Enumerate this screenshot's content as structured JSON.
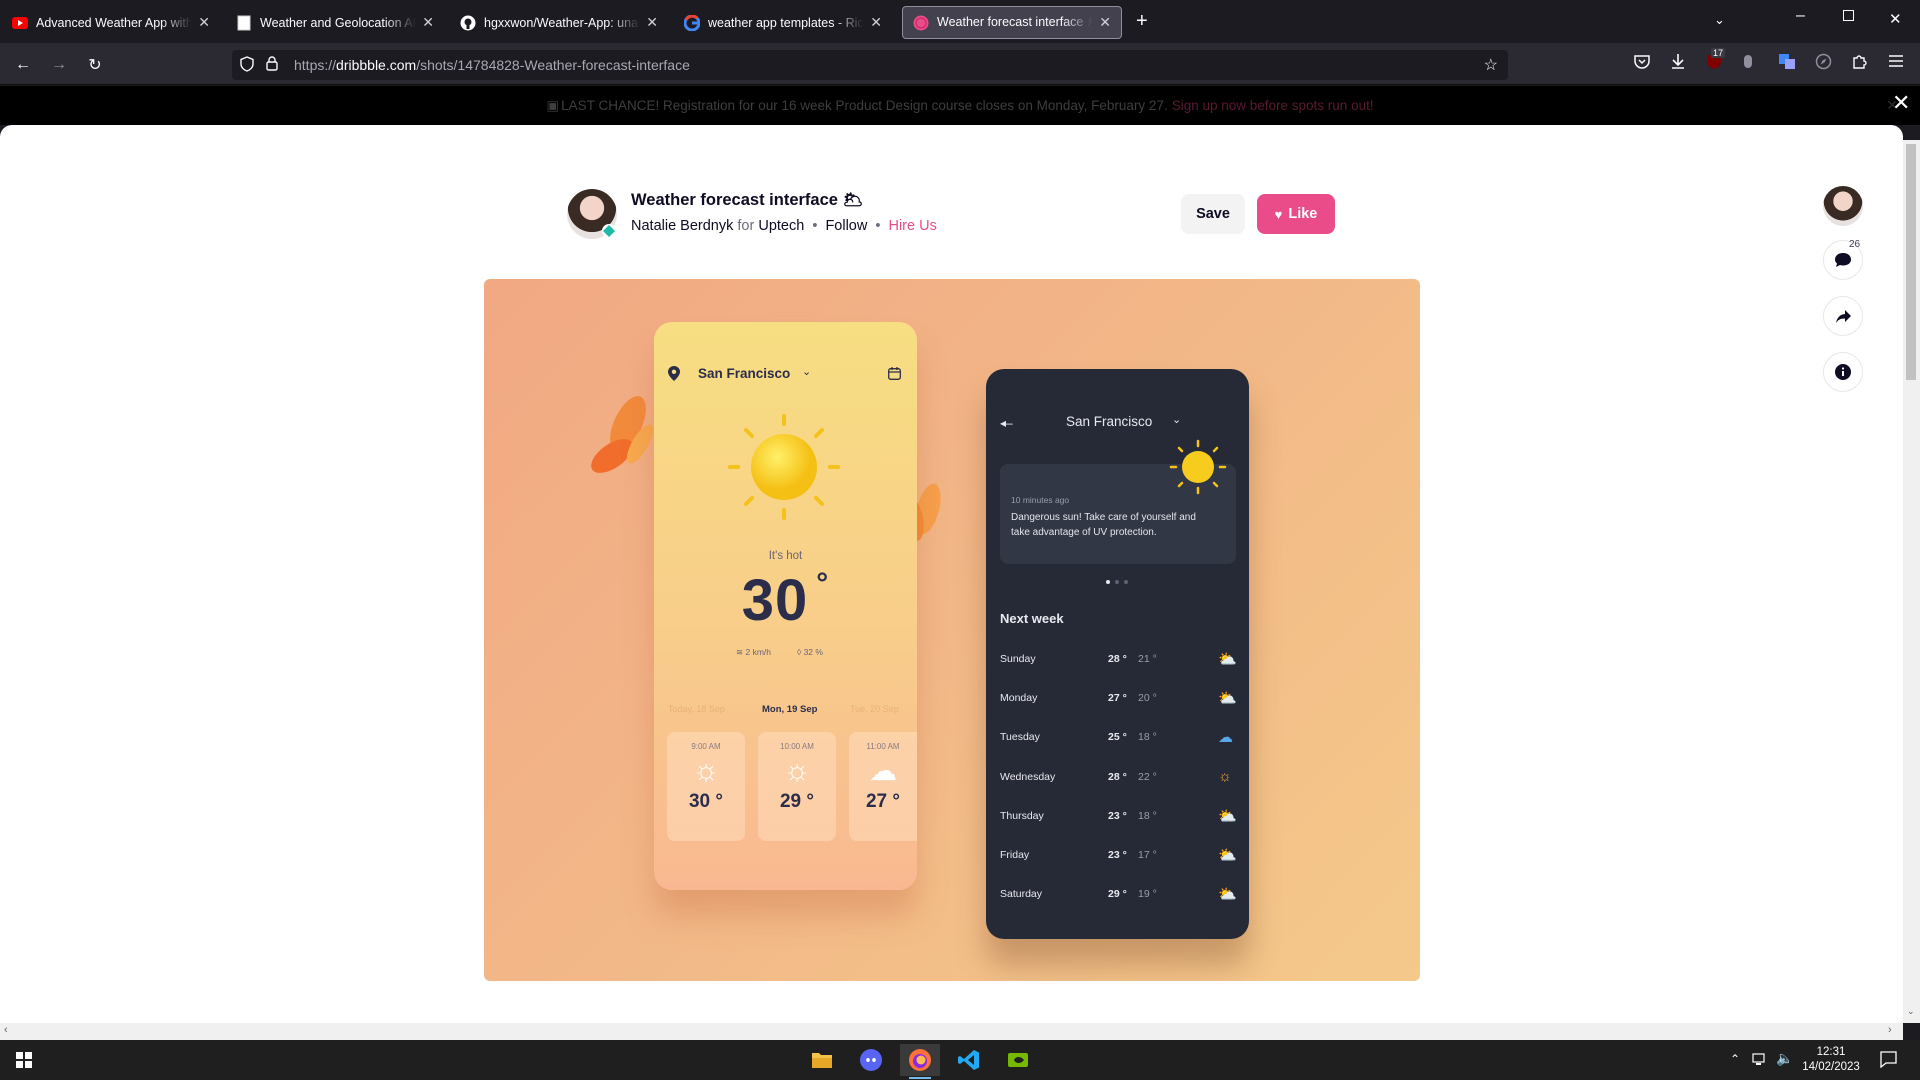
{
  "tabs": [
    {
      "title": "Advanced Weather App with JavaScript",
      "icon": "youtube-icon",
      "active": false
    },
    {
      "title": "Weather and Geolocation API - Tutorial",
      "icon": "page-icon",
      "active": false
    },
    {
      "title": "hgxxwon/Weather-App: una semplice",
      "icon": "github-icon",
      "active": false
    },
    {
      "title": "weather app templates - Ricerca Google",
      "icon": "google-icon",
      "active": false
    },
    {
      "title": "Weather forecast interface 🌥 by Natalie",
      "icon": "dribbble-icon",
      "active": true
    }
  ],
  "url": {
    "prefix": "https://",
    "domain": "dribbble.com",
    "path": "/shots/14784828-Weather-forecast-interface"
  },
  "notification_badge": "17",
  "banner": {
    "text": "LAST CHANCE! Registration for our 16 week Product Design course closes on Monday, February 27.",
    "link": "Sign up now before spots run out!"
  },
  "shot": {
    "title": "Weather forecast interface 🌥",
    "author": "Natalie Berdnyk",
    "for_word": "for",
    "team": "Uptech",
    "follow": "Follow",
    "hire": "Hire Us",
    "save_label": "Save",
    "like_label": "Like",
    "comments_count": "26"
  },
  "light_phone": {
    "city": "San Francisco",
    "condition": "It's hot",
    "temp": "30",
    "degree": "°",
    "wind": "2 km/h",
    "humidity": "32 %",
    "days": [
      "Today, 18 Sep",
      "Mon, 19 Sep",
      "Tue, 20 Sep"
    ],
    "hours": [
      {
        "time": "9:00 AM",
        "temp": "30 °",
        "icon": "sun-icon"
      },
      {
        "time": "10:00 AM",
        "temp": "29 °",
        "icon": "sun-icon"
      },
      {
        "time": "11:00 AM",
        "temp": "27 °",
        "icon": "cloud-icon"
      }
    ]
  },
  "dark_phone": {
    "city": "San Francisco",
    "alert_time": "10 minutes ago",
    "alert_text": "Dangerous sun! Take care of yourself and take advantage of UV protection.",
    "next_week": "Next week",
    "days": [
      {
        "day": "Sunday",
        "high": "28 °",
        "low": "21 °",
        "icon": "partly-sunny-icon",
        "color": "#f2a93b"
      },
      {
        "day": "Monday",
        "high": "27 °",
        "low": "20 °",
        "icon": "partly-sunny-icon",
        "color": "#f2a93b"
      },
      {
        "day": "Tuesday",
        "high": "25 °",
        "low": "18 °",
        "icon": "rain-cloud-icon",
        "color": "#5aa7e6"
      },
      {
        "day": "Wednesday",
        "high": "28 °",
        "low": "22 °",
        "icon": "sun-icon",
        "color": "#f2a93b"
      },
      {
        "day": "Thursday",
        "high": "23 °",
        "low": "18 °",
        "icon": "partly-cloudy-icon",
        "color": "#c9cad3"
      },
      {
        "day": "Friday",
        "high": "23 °",
        "low": "17 °",
        "icon": "partly-cloudy-icon",
        "color": "#c9cad3"
      },
      {
        "day": "Saturday",
        "high": "29 °",
        "low": "19 °",
        "icon": "partly-sunny-icon",
        "color": "#f2a93b"
      }
    ]
  },
  "taskbar": {
    "time": "12:31",
    "date": "14/02/2023"
  },
  "colors": {
    "brand_pink": "#ea4c89",
    "shot_bg": "#f2b587",
    "dark_phone": "#262a37"
  }
}
